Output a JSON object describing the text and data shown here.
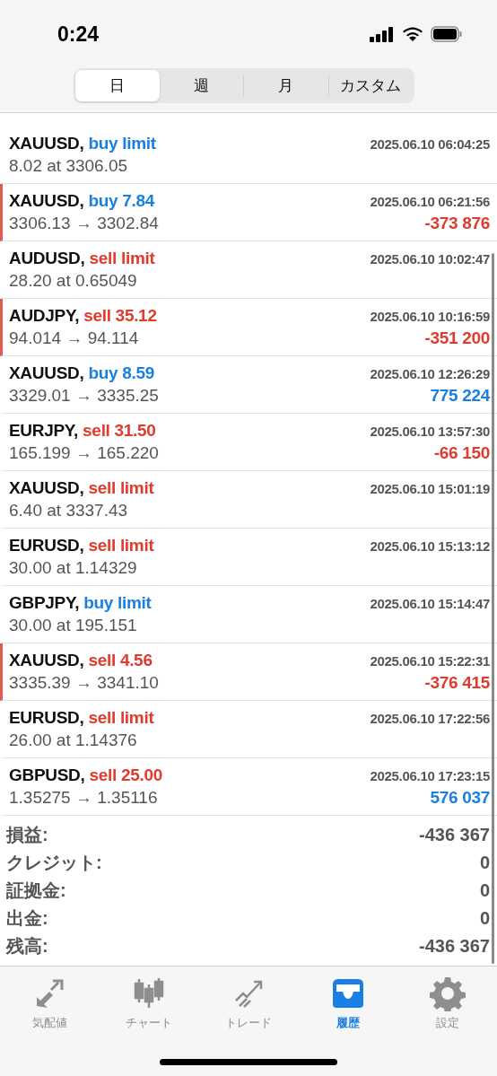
{
  "status_bar": {
    "time": "0:24"
  },
  "period_tabs": [
    {
      "label": "日",
      "selected": true
    },
    {
      "label": "週",
      "selected": false
    },
    {
      "label": "月",
      "selected": false
    },
    {
      "label": "カスタム",
      "selected": false
    }
  ],
  "history": [
    {
      "kind": "order",
      "symbol": "XAUUSD,",
      "is_buy": true,
      "action": "buy limit",
      "time": "2025.06.10 06:04:25",
      "detail": "8.02 at 3306.05",
      "marked": false
    },
    {
      "kind": "deal",
      "symbol": "XAUUSD,",
      "is_buy": true,
      "action": "buy 7.84",
      "time": "2025.06.10 06:21:56",
      "detail": "3306.13 → 3302.84",
      "profit": "-373 876",
      "gain": false,
      "marked": true
    },
    {
      "kind": "order",
      "symbol": "AUDUSD,",
      "is_buy": false,
      "action": "sell limit",
      "time": "2025.06.10 10:02:47",
      "detail": "28.20 at 0.65049",
      "marked": false
    },
    {
      "kind": "deal",
      "symbol": "AUDJPY,",
      "is_buy": false,
      "action": "sell 35.12",
      "time": "2025.06.10 10:16:59",
      "detail": "94.014 → 94.114",
      "profit": "-351 200",
      "gain": false,
      "marked": true
    },
    {
      "kind": "deal",
      "symbol": "XAUUSD,",
      "is_buy": true,
      "action": "buy 8.59",
      "time": "2025.06.10 12:26:29",
      "detail": "3329.01 → 3335.25",
      "profit": "775 224",
      "gain": true,
      "marked": false
    },
    {
      "kind": "deal",
      "symbol": "EURJPY,",
      "is_buy": false,
      "action": "sell 31.50",
      "time": "2025.06.10 13:57:30",
      "detail": "165.199 → 165.220",
      "profit": "-66 150",
      "gain": false,
      "marked": false
    },
    {
      "kind": "order",
      "symbol": "XAUUSD,",
      "is_buy": false,
      "action": "sell limit",
      "time": "2025.06.10 15:01:19",
      "detail": "6.40 at 3337.43",
      "marked": false
    },
    {
      "kind": "order",
      "symbol": "EURUSD,",
      "is_buy": false,
      "action": "sell limit",
      "time": "2025.06.10 15:13:12",
      "detail": "30.00 at 1.14329",
      "marked": false
    },
    {
      "kind": "order",
      "symbol": "GBPJPY,",
      "is_buy": true,
      "action": "buy limit",
      "time": "2025.06.10 15:14:47",
      "detail": "30.00 at 195.151",
      "marked": false
    },
    {
      "kind": "deal",
      "symbol": "XAUUSD,",
      "is_buy": false,
      "action": "sell 4.56",
      "time": "2025.06.10 15:22:31",
      "detail": "3335.39 → 3341.10",
      "profit": "-376 415",
      "gain": false,
      "marked": true
    },
    {
      "kind": "order",
      "symbol": "EURUSD,",
      "is_buy": false,
      "action": "sell limit",
      "time": "2025.06.10 17:22:56",
      "detail": "26.00 at 1.14376",
      "marked": false
    },
    {
      "kind": "deal",
      "symbol": "GBPUSD,",
      "is_buy": false,
      "action": "sell 25.00",
      "time": "2025.06.10 17:23:15",
      "detail": "1.35275 → 1.35116",
      "profit": "576 037",
      "gain": true,
      "marked": false
    }
  ],
  "summary": [
    {
      "label": "損益:",
      "value": "-436 367"
    },
    {
      "label": "クレジット:",
      "value": "0"
    },
    {
      "label": "証拠金:",
      "value": "0"
    },
    {
      "label": "出金:",
      "value": "0"
    },
    {
      "label": "残高:",
      "value": "-436 367"
    }
  ],
  "tab_bar": [
    {
      "kind": "quotes",
      "label": "気配値",
      "selected": false
    },
    {
      "kind": "chart",
      "label": "チャート",
      "selected": false
    },
    {
      "kind": "trade",
      "label": "トレード",
      "selected": false
    },
    {
      "kind": "history",
      "label": "履歴",
      "selected": true
    },
    {
      "kind": "settings",
      "label": "設定",
      "selected": false
    }
  ]
}
